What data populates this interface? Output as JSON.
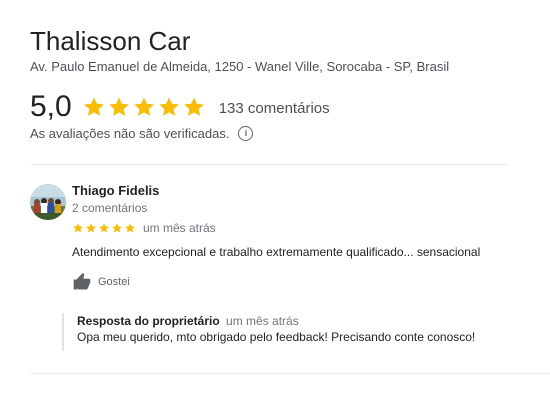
{
  "business": {
    "name": "Thalisson Car",
    "address": "Av. Paulo Emanuel de Almeida, 1250 - Wanel Ville, Sorocaba - SP, Brasil",
    "rating": "5,0",
    "rating_stars": 5,
    "review_count": "133 comentários",
    "verification_note": "As avaliações não são verificadas.",
    "info_icon": "info-icon"
  },
  "review": {
    "reviewer_name": "Thiago Fidelis",
    "reviewer_reviews": "2 comentários",
    "stars": 5,
    "time": "um mês atrás",
    "text": "Atendimento excepcional e trabalho extremamente qualificado... sensacional",
    "like_label": "Gostei",
    "like_icon": "thumbs-up-icon"
  },
  "owner_reply": {
    "label": "Resposta do proprietário",
    "time": "um mês atrás",
    "text": "Opa meu querido, mto obrigado pelo feedback! Precisando conte conosco!"
  },
  "colors": {
    "star": "#fbbc04",
    "secondary_text": "#70757a",
    "divider": "#ececec"
  }
}
